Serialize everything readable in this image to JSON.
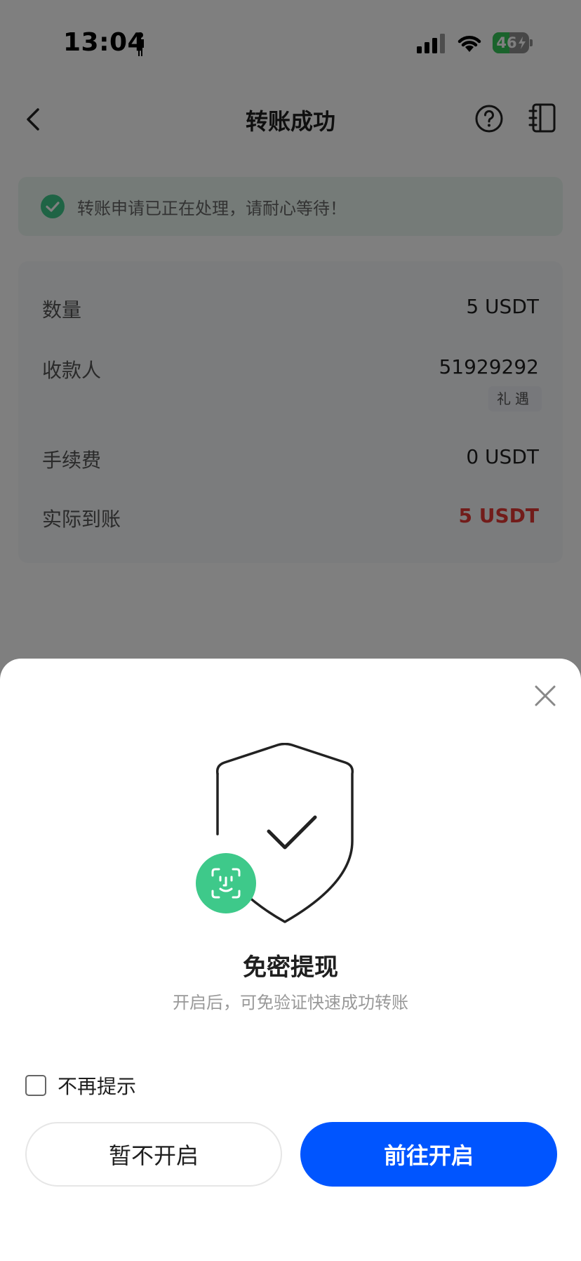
{
  "status_bar": {
    "time": "13:04",
    "battery_level": "46",
    "battery_percent": 0.46
  },
  "header": {
    "title": "转账成功"
  },
  "notice": {
    "text": "转账申请已正在处理，请耐心等待！"
  },
  "details": {
    "quantity_label": "数量",
    "quantity_value": "5 USDT",
    "payee_label": "收款人",
    "payee_value": "51929292",
    "payee_tag": "礼遇",
    "fee_label": "手续费",
    "fee_value": "0 USDT",
    "actual_label": "实际到账",
    "actual_value": "5 USDT"
  },
  "sheet": {
    "title": "免密提现",
    "subtitle": "开启后，可免验证快速成功转账",
    "dont_remind_label": "不再提示",
    "dont_remind_checked": false,
    "cancel_label": "暂不开启",
    "confirm_label": "前往开启"
  },
  "colors": {
    "primary_button": "#0055ff",
    "success_green": "#3ec98a",
    "actual_amount_red": "#e53935"
  }
}
